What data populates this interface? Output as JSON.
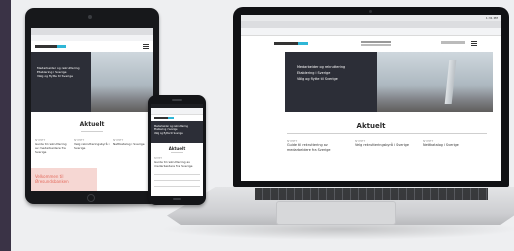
{
  "site": {
    "nav_items": [
      "Medarbeider og rekruttering",
      "Etablering i Sverige",
      "Välg og flytte til Sverige"
    ],
    "news_heading": "Aktuelt",
    "tablet_cards": [
      {
        "label": "NYHET",
        "title": "Guide til rekruttering av medarbeidere fra Sverige"
      },
      {
        "label": "NYHET",
        "title": "Velg rekrutteringsbyrå i Sverige"
      },
      {
        "label": "NYHET",
        "title": "Nettkatalog i Sverige"
      }
    ],
    "phone_card": {
      "label": "NYHET",
      "title": "Guide til rekruttering av medarbeidere fra Sverige"
    },
    "laptop_cards": [
      {
        "label": "NYHET",
        "title": "Guide til rekruttering av medarbeidere fra Sverige"
      },
      {
        "label": "NYHET",
        "title": "Velg rekrutteringsbyrå i Sverige"
      },
      {
        "label": "NYHET",
        "title": "Nettkatalog i Sverige"
      }
    ],
    "promo_title": "Velkommen til Øresundsbanken",
    "laptop_clock": "1:31 PM"
  },
  "colors": {
    "accent": "#2fb6d6",
    "hero_dark": "#2c2e37",
    "promo_bg": "#f6d7d3",
    "promo_text": "#e36a5c",
    "sidebar_stripe": "#3a3346"
  }
}
